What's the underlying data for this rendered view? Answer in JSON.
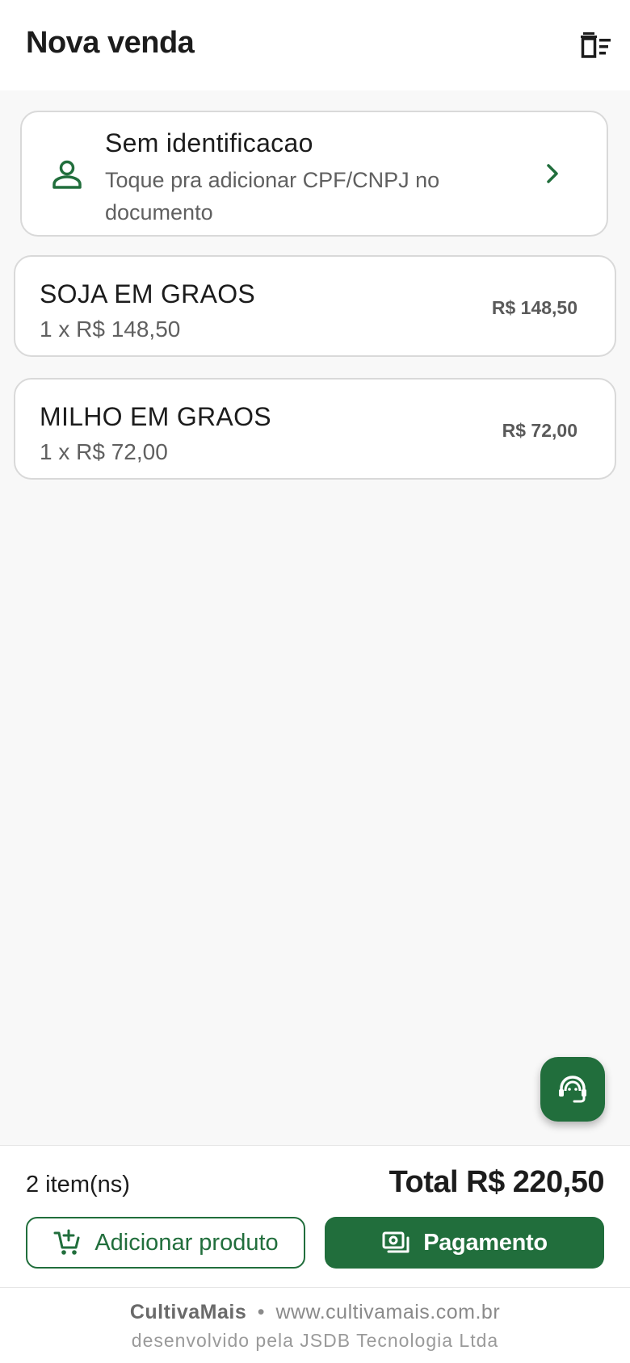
{
  "header": {
    "title": "Nova venda",
    "clear_icon": "delete-sweep-icon"
  },
  "customer": {
    "icon": "person-icon",
    "title": "Sem identificacao",
    "subtitle": "Toque pra adicionar CPF/CNPJ no documento",
    "chevron_icon": "chevron-right-icon"
  },
  "items": [
    {
      "name": "SOJA EM GRAOS",
      "qty_line": "1 x R$ 148,50",
      "total": "R$ 148,50"
    },
    {
      "name": "MILHO EM GRAOS",
      "qty_line": "1 x R$ 72,00",
      "total": "R$ 72,00"
    }
  ],
  "summary": {
    "item_count": "2 item(ns)",
    "total": "Total R$ 220,50"
  },
  "actions": {
    "add_label": "Adicionar produto",
    "add_icon": "add-shopping-cart-icon",
    "pay_label": "Pagamento",
    "pay_icon": "payments-icon"
  },
  "support": {
    "icon": "support-agent-icon"
  },
  "footer": {
    "brand": "CultivaMais",
    "separator": "•",
    "website": "www.cultivamais.com.br",
    "developer": "desenvolvido pela JSDB Tecnologia Ltda"
  },
  "colors": {
    "primary": "#216e3c",
    "background": "#f8f8f8",
    "card_border": "#d9d9d9",
    "text_primary": "#1c1c1c",
    "text_secondary": "#606060"
  }
}
